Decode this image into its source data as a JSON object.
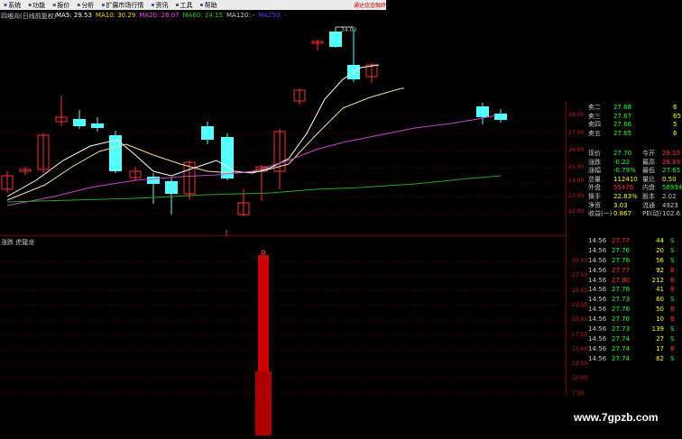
{
  "menu": [
    {
      "label": "系统"
    },
    {
      "label": "功能"
    },
    {
      "label": "报价"
    },
    {
      "label": "分析"
    },
    {
      "label": "扩展市场行情"
    },
    {
      "label": "资讯"
    },
    {
      "label": "工具"
    },
    {
      "label": "帮助"
    }
  ],
  "notice": "通达信金融终",
  "stock_title": "四维向(日线前复权)",
  "ma": [
    {
      "label": "MA5: 29.53",
      "color": "#ffffff"
    },
    {
      "label": "MA10: 30.29",
      "color": "#ffd700"
    },
    {
      "label": "MA20: 28.07",
      "color": "#ff44ff"
    },
    {
      "label": "MA60: 24.15",
      "color": "#22cc22"
    },
    {
      "label": "MA120: -",
      "color": "#cccccc"
    },
    {
      "label": "MA250: -",
      "color": "#4444ff"
    }
  ],
  "high_label": "34.00",
  "price_axis": [
    "28.00",
    "27.00",
    "26.00",
    "25.00",
    "24.00",
    "23.00",
    "22.00"
  ],
  "order_book": [
    {
      "label": "卖二",
      "price": "27.68",
      "vol": "6"
    },
    {
      "label": "卖三",
      "price": "27.67",
      "vol": "65"
    },
    {
      "label": "卖四",
      "price": "27.66",
      "vol": "5"
    },
    {
      "label": "卖五",
      "price": "27.65",
      "vol": "6"
    }
  ],
  "quote": [
    {
      "l1": "现价",
      "v1": "27.70",
      "l2": "今开",
      "v2": "28.19"
    },
    {
      "l1": "涨跌",
      "v1": "-0.22",
      "l2": "最高",
      "v2": "28.69"
    },
    {
      "l1": "涨幅",
      "v1": "-0.79%",
      "l2": "最低",
      "v2": "27.65"
    },
    {
      "l1": "总量",
      "v1": "112410",
      "l2": "量比",
      "v2": "0.50"
    },
    {
      "l1": "外盘",
      "v1": "55476",
      "l2": "内盘",
      "v2": "56934"
    },
    {
      "l1": "换手",
      "v1": "22.83%",
      "l2": "股本",
      "v2": "2.02"
    },
    {
      "l1": "净资",
      "v1": "3.03",
      "l2": "流通",
      "v2": "4923"
    },
    {
      "l1": "收益(一)",
      "v1": "0.867",
      "l2": "PE(动)",
      "v2": "102.6"
    }
  ],
  "ticks": [
    {
      "time": "14:56",
      "price": "27.77",
      "vol": "44",
      "side": "S"
    },
    {
      "time": "14:56",
      "price": "27.76",
      "vol": "20",
      "side": "S"
    },
    {
      "time": "14:56",
      "price": "27.76",
      "vol": "56",
      "side": "S"
    },
    {
      "time": "14:56",
      "price": "27.77",
      "vol": "92",
      "side": "B"
    },
    {
      "time": "14:56",
      "price": "27.80",
      "vol": "212",
      "side": "B"
    },
    {
      "time": "14:56",
      "price": "27.76",
      "vol": "41",
      "side": "B"
    },
    {
      "time": "14:56",
      "price": "27.73",
      "vol": "60",
      "side": "S"
    },
    {
      "time": "14:56",
      "price": "27.76",
      "vol": "50",
      "side": "B"
    },
    {
      "time": "14:56",
      "price": "27.76",
      "vol": "10",
      "side": "B"
    },
    {
      "time": "14:56",
      "price": "27.73",
      "vol": "139",
      "side": "S"
    },
    {
      "time": "14:56",
      "price": "27.74",
      "vol": "27",
      "side": "S"
    },
    {
      "time": "14:56",
      "price": "27.74",
      "vol": "17",
      "side": "B"
    },
    {
      "time": "14:56",
      "price": "27.74",
      "vol": "62",
      "side": "S"
    }
  ],
  "indicator_label": "涨跌 虎龍龙",
  "indicator_axis": [
    "30.00",
    "27.50",
    "25.00",
    "22.50",
    "20.00",
    "17.50",
    "15.00",
    "12.50",
    "10.00",
    "7.50"
  ],
  "watermark": "www.7gpzb.com",
  "colors": {
    "up": "#ff3030",
    "down": "#55ffff",
    "ma5": "#ffffff",
    "ma10": "#f0e0a0",
    "ma20": "#cc44cc",
    "ma60": "#22aa22",
    "volume_bar": "#cc0000"
  }
}
